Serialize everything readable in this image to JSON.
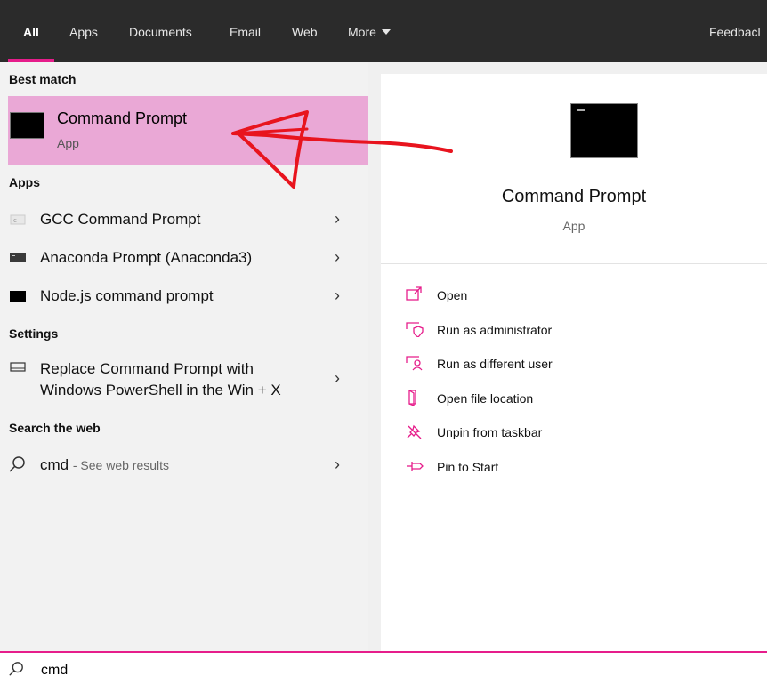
{
  "tabs": [
    "All",
    "Apps",
    "Documents",
    "Email",
    "Web",
    "More"
  ],
  "feedback_label": "Feedbacl",
  "sections": {
    "best_match": "Best match",
    "apps": "Apps",
    "settings": "Settings",
    "search_web": "Search the web"
  },
  "best_match": {
    "name": "Command Prompt",
    "type": "App"
  },
  "apps": [
    {
      "label": "GCC Command Prompt",
      "icon": "gcc-icon"
    },
    {
      "label": "Anaconda Prompt (Anaconda3)",
      "icon": "anaconda-terminal-icon"
    },
    {
      "label": "Node.js command prompt",
      "icon": "node-terminal-icon"
    }
  ],
  "settings": {
    "line1": "Replace Command Prompt with",
    "line2": "Windows PowerShell in the Win + X"
  },
  "web": {
    "query": "cmd",
    "hint": "- See web results"
  },
  "preview": {
    "title": "Command Prompt",
    "subtitle": "App"
  },
  "actions": [
    {
      "label": "Open",
      "icon": "open-icon"
    },
    {
      "label": "Run as administrator",
      "icon": "shield-admin-icon"
    },
    {
      "label": "Run as different user",
      "icon": "user-switch-icon"
    },
    {
      "label": "Open file location",
      "icon": "folder-location-icon"
    },
    {
      "label": "Unpin from taskbar",
      "icon": "unpin-icon"
    },
    {
      "label": "Pin to Start",
      "icon": "pin-icon"
    }
  ],
  "search": {
    "value": "cmd"
  },
  "colors": {
    "accent": "#e61d8b",
    "highlight": "#eaa8d6",
    "annotation": "#e8141e"
  }
}
